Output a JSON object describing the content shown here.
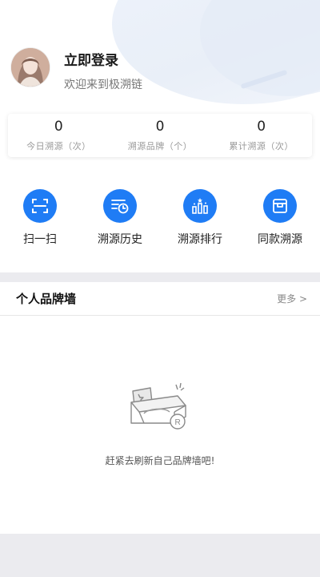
{
  "profile": {
    "login_label": "立即登录",
    "welcome_text": "欢迎来到极溯链"
  },
  "stats": [
    {
      "value": "0",
      "label": "今日溯源（次）"
    },
    {
      "value": "0",
      "label": "溯源品牌（个）"
    },
    {
      "value": "0",
      "label": "累计溯源（次）"
    }
  ],
  "actions": [
    {
      "label": "扫一扫",
      "icon": "scan-icon"
    },
    {
      "label": "溯源历史",
      "icon": "history-icon"
    },
    {
      "label": "溯源排行",
      "icon": "ranking-icon"
    },
    {
      "label": "同款溯源",
      "icon": "box-icon"
    }
  ],
  "brand_wall": {
    "title": "个人品牌墙",
    "more_label": "更多 >",
    "empty_text": "赶紧去刷新自己品牌墙吧!"
  },
  "colors": {
    "accent": "#1f7cf5",
    "page_bg": "#ebebef"
  }
}
